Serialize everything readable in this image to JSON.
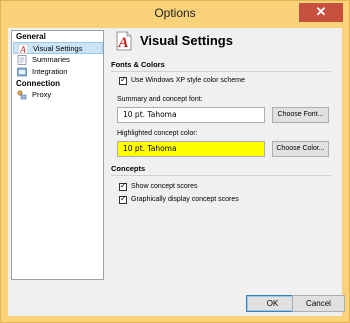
{
  "window": {
    "title": "Options",
    "close_glyph": "✕"
  },
  "sidebar": {
    "groups": [
      {
        "label": "General"
      },
      {
        "label": "Connection"
      }
    ],
    "items": [
      {
        "label": "Visual Settings",
        "icon": "visual-settings-icon",
        "selected": true
      },
      {
        "label": "Summaries",
        "icon": "summaries-icon"
      },
      {
        "label": "Integration",
        "icon": "integration-icon"
      },
      {
        "label": "Proxy",
        "icon": "proxy-icon"
      }
    ]
  },
  "page": {
    "title": "Visual Settings",
    "icon": "visual-settings-icon",
    "fonts_colors": {
      "title": "Fonts & Colors",
      "xp_style_label": "Use Windows XP style color scheme",
      "xp_style_checked": true,
      "summary_font_label": "Summary and concept font:",
      "summary_font_value": "10 pt. Tahoma",
      "choose_font_label": "Choose Font...",
      "highlight_color_label": "Highlighted concept color:",
      "highlight_color_value": "10 pt. Tahoma",
      "highlight_color": "#ffff00",
      "choose_color_label": "Choose Color..."
    },
    "concepts": {
      "title": "Concepts",
      "show_scores_label": "Show concept scores",
      "show_scores_checked": true,
      "graphic_scores_label": "Graphically display concept scores",
      "graphic_scores_checked": true
    }
  },
  "footer": {
    "ok_label": "OK",
    "cancel_label": "Cancel"
  }
}
